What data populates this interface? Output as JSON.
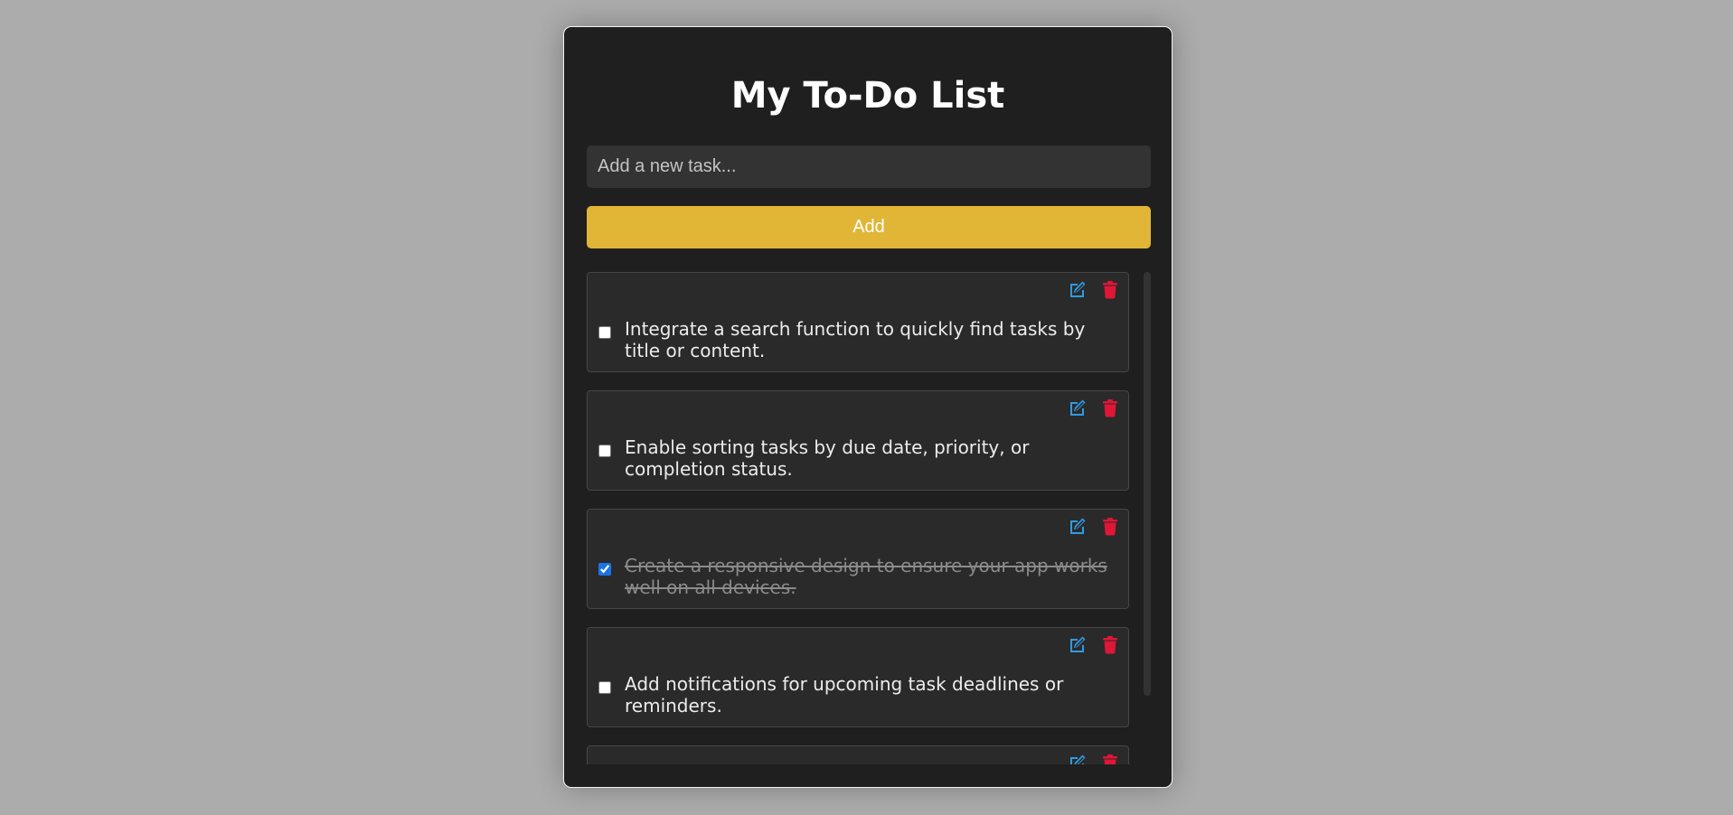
{
  "app": {
    "title": "My To-Do List"
  },
  "form": {
    "input_placeholder": "Add a new task...",
    "input_value": "",
    "add_label": "Add"
  },
  "icons": {
    "edit": "edit-icon",
    "delete": "trash-icon"
  },
  "colors": {
    "background": "#acacac",
    "panel": "#1f1f1f",
    "accent_button": "#e1b536",
    "edit_icon": "#2f9be3",
    "delete_icon": "#e01636",
    "checkbox_checked": "#1a73e8"
  },
  "tasks": [
    {
      "text": "Integrate a search function to quickly find tasks by title or content.",
      "done": false
    },
    {
      "text": "Enable sorting tasks by due date, priority, or completion status.",
      "done": false
    },
    {
      "text": "Create a responsive design to ensure your app works well on all devices.",
      "done": true
    },
    {
      "text": "Add notifications for upcoming task deadlines or reminders.",
      "done": false
    },
    {
      "text": "",
      "done": false
    }
  ]
}
